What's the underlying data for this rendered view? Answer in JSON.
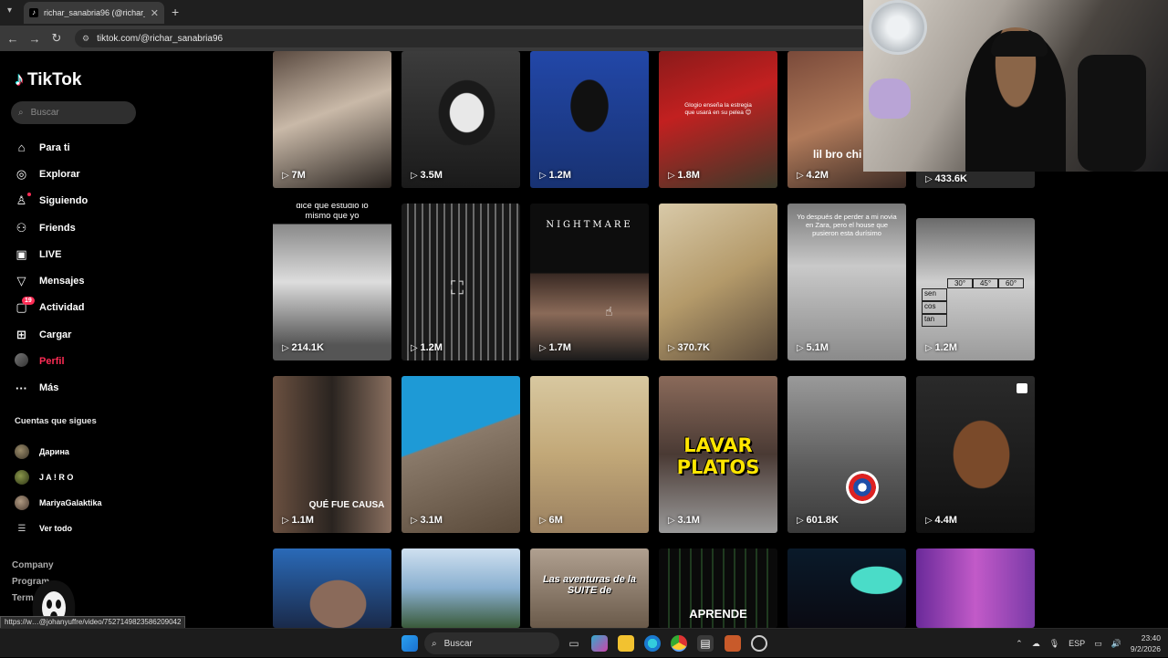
{
  "browser": {
    "tab_title": "richar_sanabria96 (@richar_sa…",
    "url": "tiktok.com/@richar_sanabria96"
  },
  "sidebar": {
    "logo": "TikTok",
    "search_placeholder": "Buscar",
    "nav": [
      {
        "label": "Para ti",
        "icon": "home-icon"
      },
      {
        "label": "Explorar",
        "icon": "compass-icon"
      },
      {
        "label": "Siguiendo",
        "icon": "following-icon"
      },
      {
        "label": "Friends",
        "icon": "friends-icon"
      },
      {
        "label": "LIVE",
        "icon": "live-icon"
      },
      {
        "label": "Mensajes",
        "icon": "messages-icon"
      },
      {
        "label": "Actividad",
        "icon": "activity-icon",
        "badge": "19"
      },
      {
        "label": "Cargar",
        "icon": "upload-icon"
      },
      {
        "label": "Perfil",
        "icon": "profile-avatar"
      },
      {
        "label": "Más",
        "icon": "more-icon"
      }
    ],
    "following_title": "Cuentas que sigues",
    "following": [
      "Дарина",
      "J A ! R O",
      "MariyaGalaktika"
    ],
    "see_all": "Ver todo",
    "footer": [
      "Company",
      "Program",
      "Terms"
    ]
  },
  "grid": {
    "rows": [
      [
        {
          "views": "7M"
        },
        {
          "views": "3.5M"
        },
        {
          "views": "1.2M"
        },
        {
          "views": "1.8M",
          "caption": "Glogio enseña la estregia que usará en su pelea 😊"
        },
        {
          "views": "4.2M",
          "caption": "lil bro chi"
        },
        {
          "views": "433.6K"
        }
      ],
      [
        {
          "views": "214.1K",
          "caption": "dice que estudio lo mismo que yo"
        },
        {
          "views": "1.2M"
        },
        {
          "views": "1.7M",
          "caption": "NIGHTMARE"
        },
        {
          "views": "370.7K"
        },
        {
          "views": "5.1M",
          "caption": "Yo después de perder a mi novia en Zara, pero el house que pusieron esta durísimo"
        },
        {
          "views": "1.2M"
        }
      ],
      [
        {
          "views": "1.1M",
          "caption": "QUÉ FUE CAUSA"
        },
        {
          "views": "3.1M"
        },
        {
          "views": "6M"
        },
        {
          "views": "3.1M",
          "caption": "LAVAR PLATOS"
        },
        {
          "views": "601.8K"
        },
        {
          "views": "4.4M"
        }
      ],
      [
        {
          "views": ""
        },
        {
          "views": ""
        },
        {
          "views": "",
          "caption": "Las aventuras de la SUITE de"
        },
        {
          "views": "",
          "caption": "APRENDE"
        },
        {
          "views": ""
        },
        {
          "views": ""
        }
      ]
    ],
    "trig_table": {
      "headers": [
        "30°",
        "45°",
        "60°"
      ],
      "rows": [
        "sen",
        "cos",
        "tan"
      ]
    }
  },
  "statusbar_link": "https://w…@johanyuffre/video/7527149823586209042",
  "taskbar": {
    "search": "Buscar",
    "lang": "ESP",
    "time": "23:40",
    "date": "9/2/2026"
  }
}
